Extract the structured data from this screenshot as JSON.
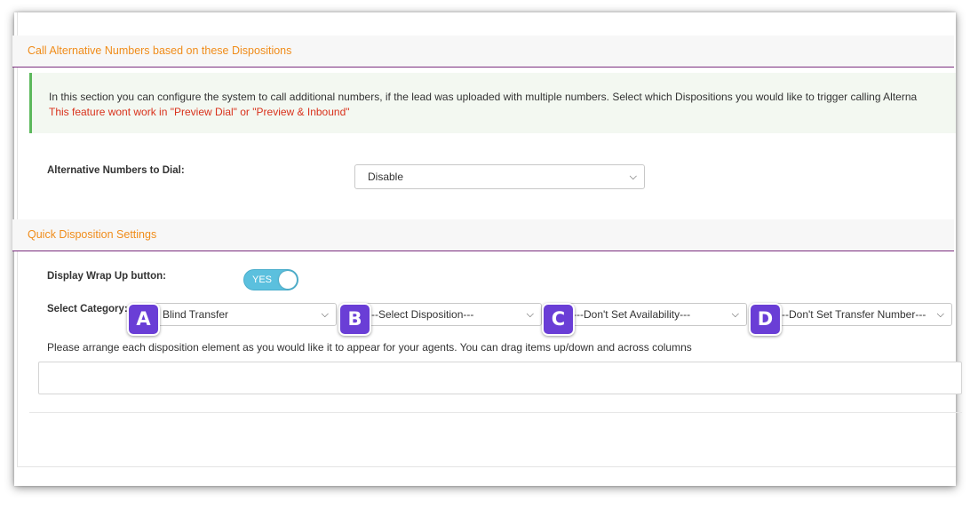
{
  "sections": {
    "alt_numbers": {
      "title": "Call Alternative Numbers based on these Dispositions"
    },
    "quick_dispo": {
      "title": "Quick Disposition Settings"
    }
  },
  "alert": {
    "info": "In this section you can configure the system to call additional numbers, if the lead was uploaded with multiple numbers. Select which Dispositions you would like to trigger calling Alterna",
    "warning": "This feature wont work in \"Preview Dial\" or \"Preview & Inbound\""
  },
  "alt_dial": {
    "label": "Alternative Numbers to Dial:",
    "value": "Disable"
  },
  "wrap_up": {
    "label": "Display Wrap Up button:",
    "toggle_text": "YES",
    "enabled": true
  },
  "category": {
    "label": "Select Category:",
    "selects": [
      {
        "badge": "A",
        "value": "Blind Transfer"
      },
      {
        "badge": "B",
        "value": "---Select Disposition---"
      },
      {
        "badge": "C",
        "value": "---Don't Set Availability---"
      },
      {
        "badge": "D",
        "value": "---Don't Set Transfer Number---"
      }
    ]
  },
  "arrange_note": "Please arrange each disposition element as you would like it to appear for your agents. You can drag items up/down and across columns",
  "colors": {
    "accent_orange": "#f08c1a",
    "divider_purple": "#7b2d7f",
    "badge_purple": "#6a3ed6",
    "toggle_blue": "#5bc0de"
  }
}
